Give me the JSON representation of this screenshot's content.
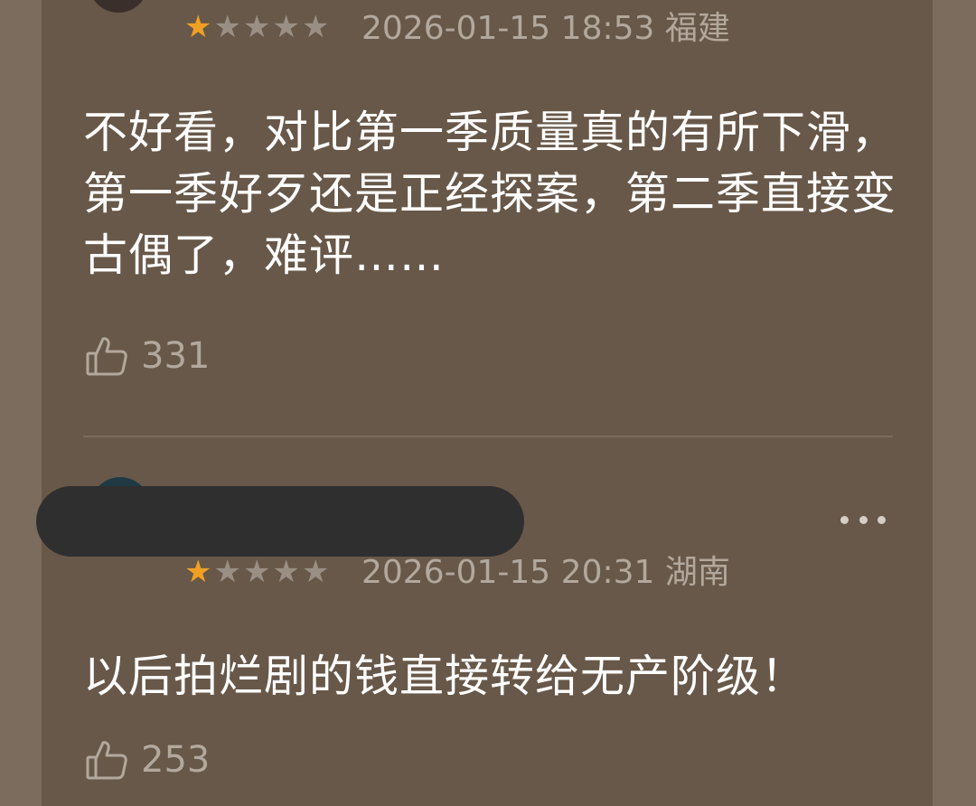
{
  "reviews": [
    {
      "rating": 1,
      "max_rating": 5,
      "timestamp": "2026-01-15 18:53",
      "location": "福建",
      "text": "不好看，对比第一季质量真的有所下滑，第一季好歹还是正经探案，第二季直接变古偶了，难评……",
      "likes": "331"
    },
    {
      "rating": 1,
      "max_rating": 5,
      "timestamp": "2026-01-15 20:31",
      "location": "湖南",
      "text": "以后拍烂剧的钱直接转给无产阶级！",
      "likes": "253"
    }
  ],
  "icons": {
    "like": "thumbs-up-icon",
    "more": "more-options-icon"
  },
  "colors": {
    "star_on": "#f0a023",
    "star_off": "#9a8f85",
    "card_bg": "#685849",
    "page_bg": "#7b6c5e"
  }
}
